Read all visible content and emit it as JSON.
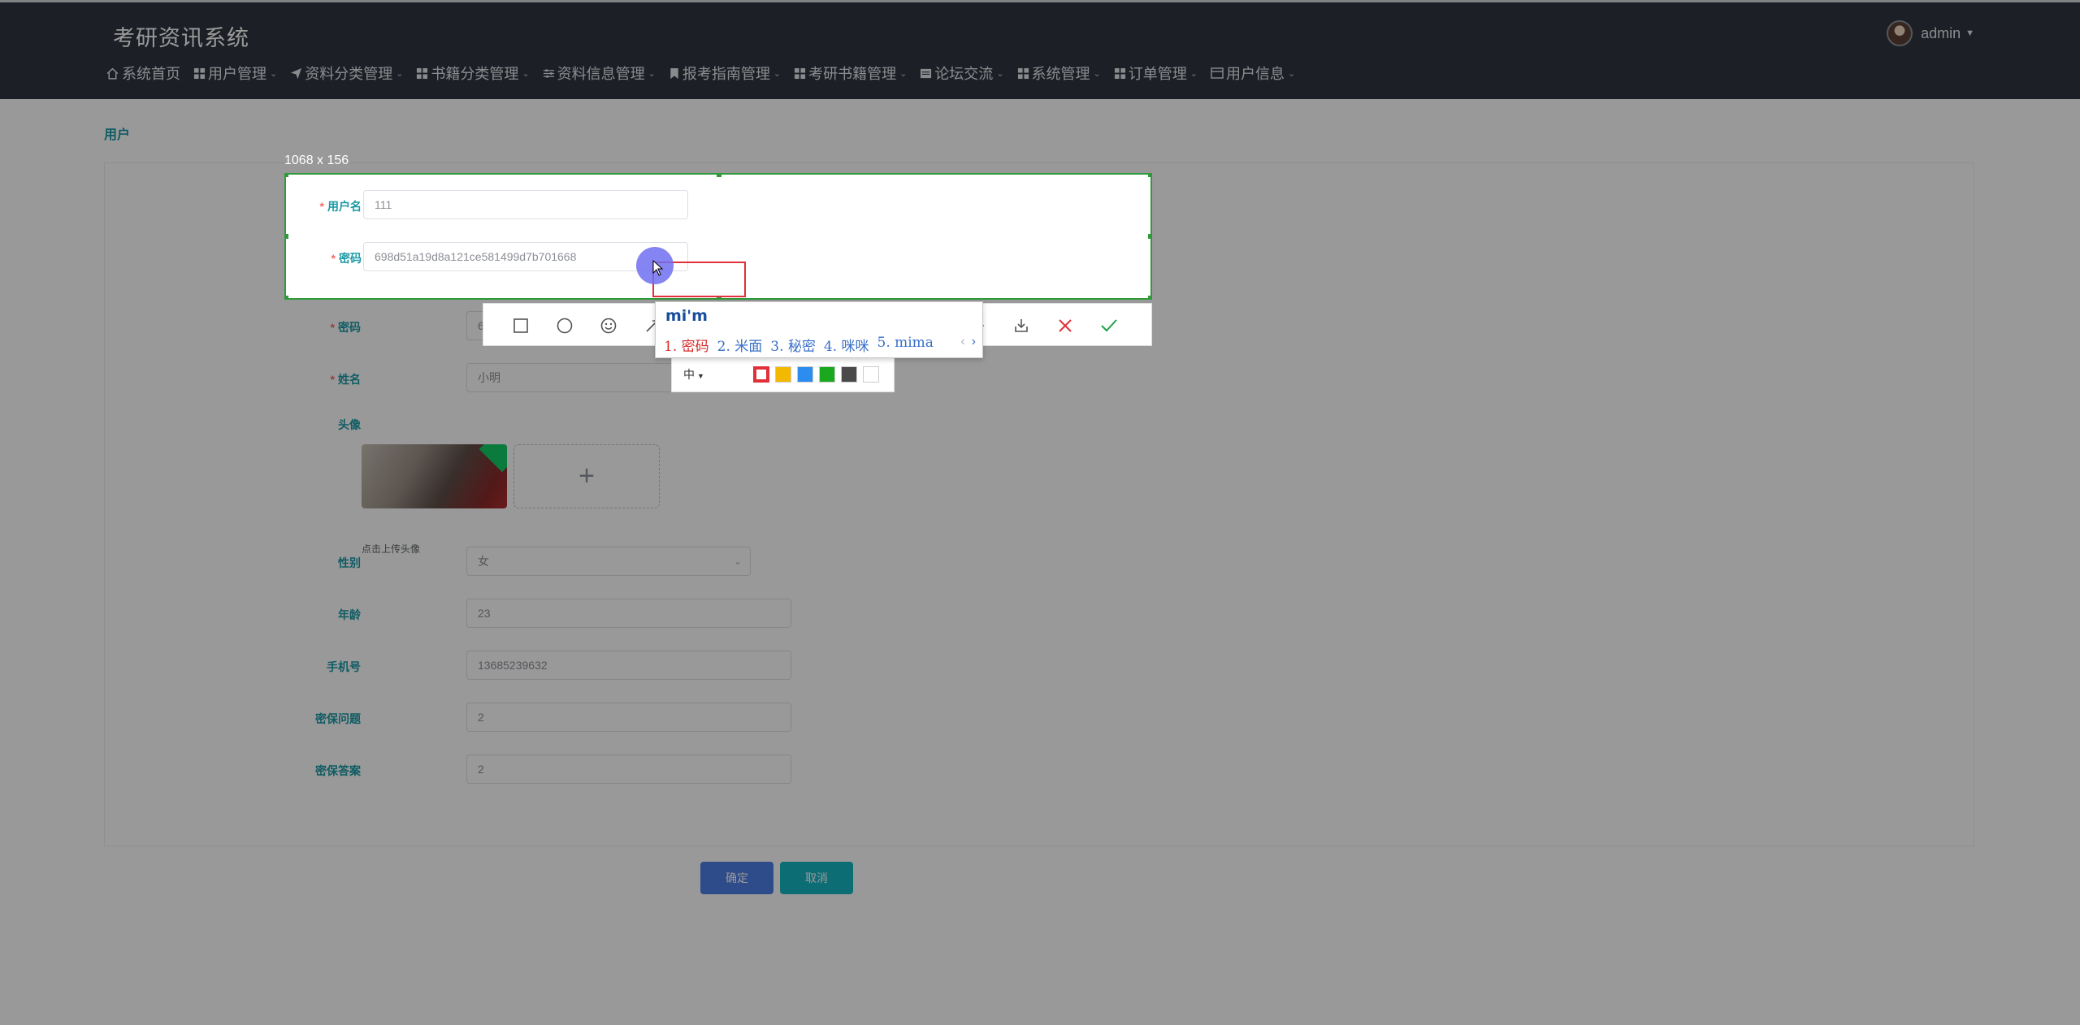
{
  "app": {
    "title": "考研资讯系统"
  },
  "user": {
    "name": "admin"
  },
  "nav": [
    {
      "label": "系统首页",
      "icon": "home-icon",
      "dropdown": false
    },
    {
      "label": "用户管理",
      "icon": "grid-icon",
      "dropdown": true
    },
    {
      "label": "资料分类管理",
      "icon": "send-icon",
      "dropdown": true
    },
    {
      "label": "书籍分类管理",
      "icon": "grid-icon",
      "dropdown": true
    },
    {
      "label": "资料信息管理",
      "icon": "sliders-icon",
      "dropdown": true
    },
    {
      "label": "报考指南管理",
      "icon": "bookmark-icon",
      "dropdown": true
    },
    {
      "label": "考研书籍管理",
      "icon": "grid-icon",
      "dropdown": true
    },
    {
      "label": "论坛交流",
      "icon": "board-icon",
      "dropdown": true
    },
    {
      "label": "系统管理",
      "icon": "grid-icon",
      "dropdown": true
    },
    {
      "label": "订单管理",
      "icon": "grid-icon",
      "dropdown": true
    },
    {
      "label": "用户信息",
      "icon": "card-icon",
      "dropdown": true
    }
  ],
  "breadcrumb": "用户",
  "form": {
    "fields": [
      {
        "key": "username",
        "label": "用户名",
        "required": true,
        "value": "111"
      },
      {
        "key": "password",
        "label": "密码",
        "required": true,
        "value": "698d51a19d8a121ce581499d7b701668"
      },
      {
        "key": "name",
        "label": "姓名",
        "required": true,
        "value": "小明"
      },
      {
        "key": "avatar",
        "label": "头像",
        "required": false,
        "value": ""
      },
      {
        "key": "gender",
        "label": "性别",
        "required": false,
        "value": "女"
      },
      {
        "key": "age",
        "label": "年龄",
        "required": false,
        "value": "23"
      },
      {
        "key": "phone",
        "label": "手机号",
        "required": false,
        "value": "13685239632"
      },
      {
        "key": "question",
        "label": "密保问题",
        "required": false,
        "value": "2"
      },
      {
        "key": "answer",
        "label": "密保答案",
        "required": false,
        "value": "2"
      }
    ],
    "upload_hint": "点击上传头像",
    "ok_label": "确定",
    "cancel_label": "取消"
  },
  "screenshot_tool": {
    "selection_size": "1068 x 156",
    "size_option": "中",
    "colors": [
      "#e0303a",
      "#f5b800",
      "#2d8cf0",
      "#19a81e",
      "#4a4a4a",
      "#ffffff"
    ]
  },
  "ime": {
    "input": "mi'm",
    "candidates": [
      "1. 密码",
      "2. 米面",
      "3. 秘密",
      "4. 咪咪",
      "5. mima"
    ],
    "prev": "‹",
    "next": "›"
  }
}
